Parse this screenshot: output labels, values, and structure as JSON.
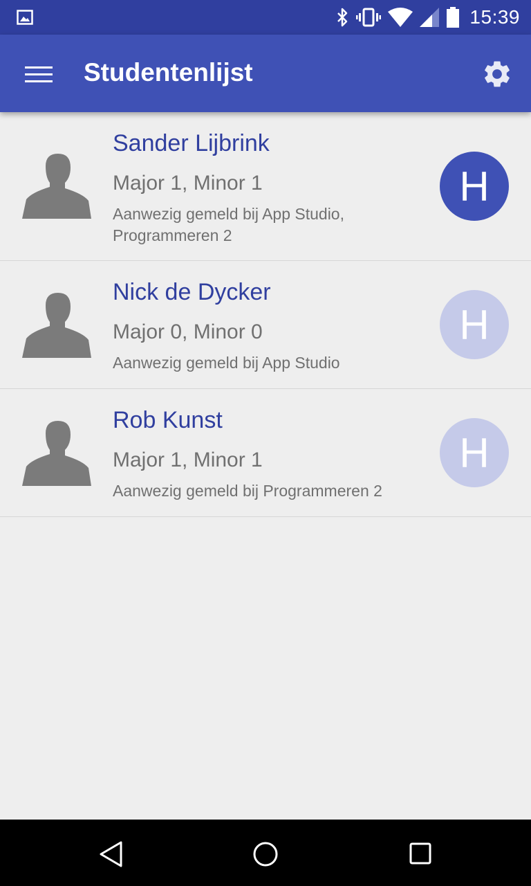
{
  "status_bar": {
    "time": "15:39"
  },
  "app_bar": {
    "title": "Studentenlijst"
  },
  "students": [
    {
      "name": "Sander Lijbrink",
      "stats": "Major 1, Minor 1",
      "presence": "Aanwezig gemeld bij App Studio, Programmeren 2",
      "badge_letter": "H",
      "badge_active": true
    },
    {
      "name": "Nick de Dycker",
      "stats": "Major 0, Minor 0",
      "presence": "Aanwezig gemeld bij App Studio",
      "badge_letter": "H",
      "badge_active": false
    },
    {
      "name": "Rob Kunst",
      "stats": "Major 1, Minor 1",
      "presence": "Aanwezig gemeld bij Programmeren 2",
      "badge_letter": "H",
      "badge_active": false
    }
  ],
  "colors": {
    "status_bar": "#303f9f",
    "app_bar": "#3f51b5",
    "badge_active": "#3f51b5",
    "badge_inactive": "#c5cae9",
    "name_text": "#303f9f"
  },
  "icons": {
    "status": [
      "gallery-icon",
      "bluetooth-icon",
      "vibrate-icon",
      "wifi-icon",
      "signal-icon",
      "battery-icon"
    ],
    "app_bar": [
      "menu-icon",
      "gear-icon"
    ],
    "navigation": [
      "back-icon",
      "home-icon",
      "recents-icon"
    ]
  }
}
